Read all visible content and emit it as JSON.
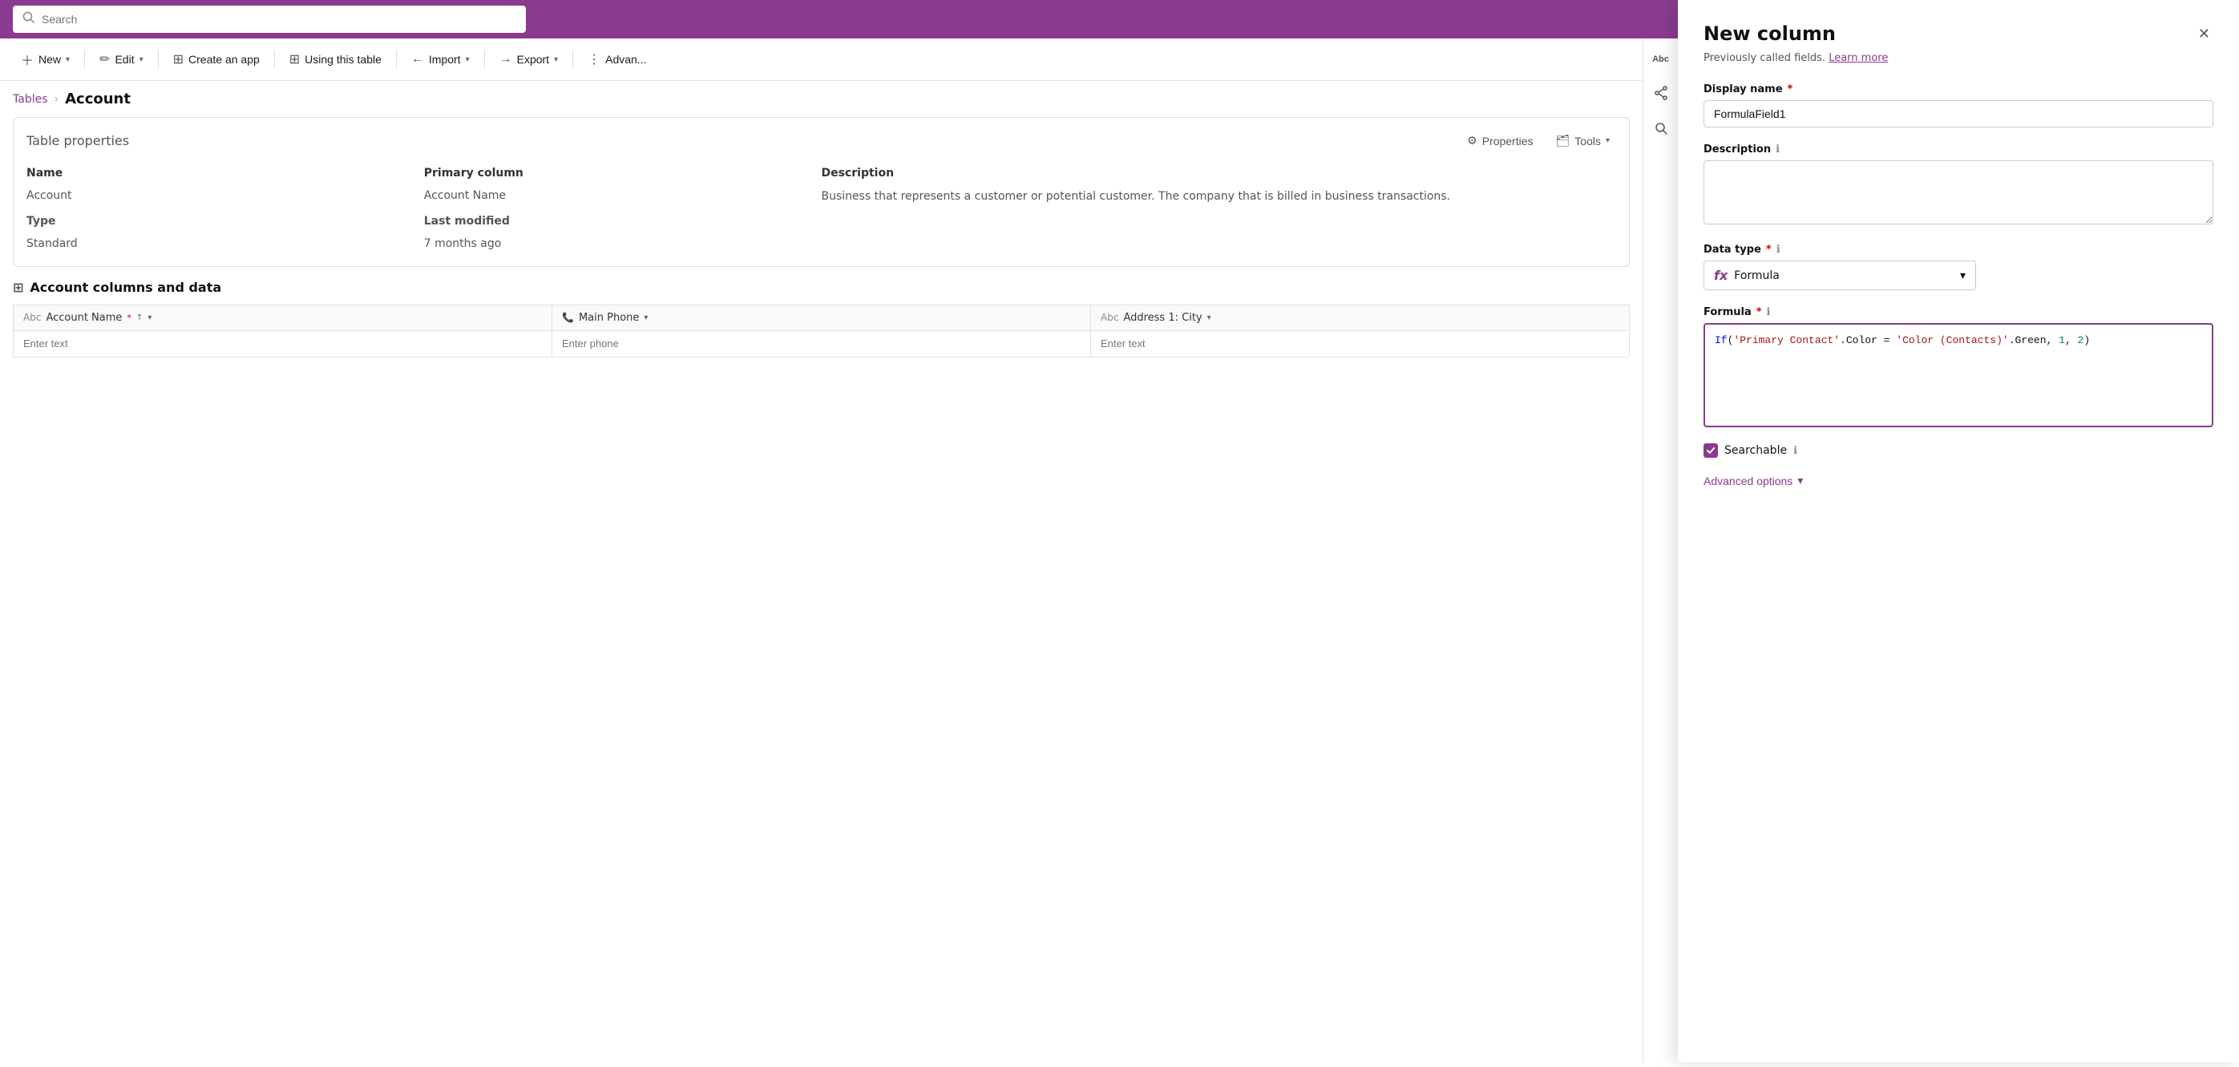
{
  "topbar": {
    "search_placeholder": "Search",
    "background_color": "#8a3b8f"
  },
  "toolbar": {
    "new_label": "New",
    "edit_label": "Edit",
    "create_app_label": "Create an app",
    "using_this_table_label": "Using this table",
    "import_label": "Import",
    "export_label": "Export",
    "advanced_label": "Advan..."
  },
  "breadcrumb": {
    "parent": "Tables",
    "current": "Account"
  },
  "table_properties": {
    "title": "Table properties",
    "properties_btn": "Properties",
    "tools_btn": "Tools",
    "col1_header": "Name",
    "col2_header": "Primary column",
    "col3_header": "Description",
    "row1_name": "Account",
    "row1_primary": "Account Name",
    "row1_desc": "Business that represents a customer or potential customer. The company that is billed in business transactions.",
    "row2_label": "Type",
    "row2_primary_label": "Last modified",
    "row2_val": "Standard",
    "row2_primary_val": "7 months ago"
  },
  "columns_section": {
    "title": "Account columns and data",
    "col1_header": "Account Name",
    "col1_required": true,
    "col2_header": "Main Phone",
    "col3_header": "Address 1: City",
    "row1_col1_placeholder": "Enter text",
    "row1_col2_placeholder": "Enter phone",
    "row1_col3_placeholder": "Enter text"
  },
  "panel": {
    "title": "New column",
    "subtitle": "Previously called fields.",
    "learn_more": "Learn more",
    "close_label": "×",
    "display_name_label": "Display name",
    "display_name_required": true,
    "display_name_value": "FormulaField1",
    "description_label": "Description",
    "description_placeholder": "",
    "data_type_label": "Data type",
    "data_type_required": true,
    "data_type_value": "Formula",
    "formula_label": "Formula",
    "formula_required": true,
    "formula_value": "If('Primary Contact'.Color = 'Color (Contacts)'.Green, 1, 2)",
    "searchable_label": "Searchable",
    "searchable_checked": true,
    "advanced_options_label": "Advanced options"
  }
}
